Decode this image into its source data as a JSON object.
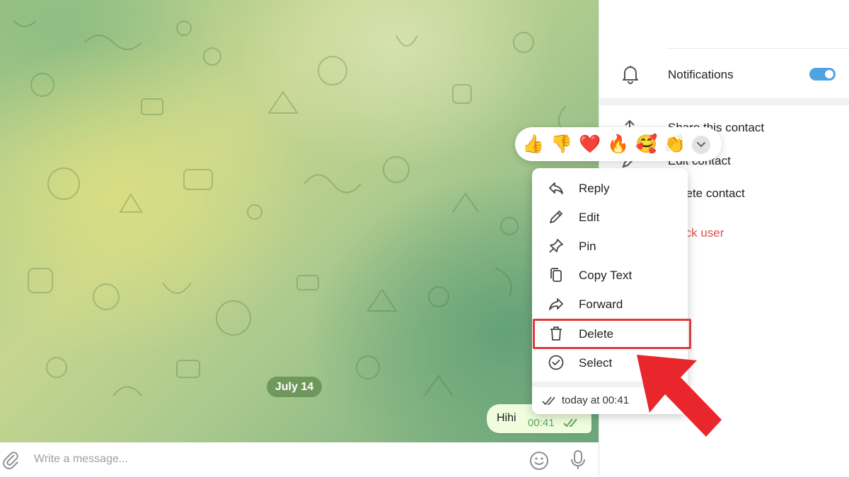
{
  "chat": {
    "date_separator": "July 14",
    "message": {
      "text": "Hihi",
      "time": "00:41",
      "status": "read"
    },
    "input_placeholder": "Write a message..."
  },
  "side_panel": {
    "notifications_label": "Notifications",
    "notifications_enabled": true,
    "items": [
      {
        "label": "Share this contact",
        "icon": "share-icon"
      },
      {
        "label": "Edit contact",
        "icon": "pencil-icon"
      },
      {
        "label": "Delete contact",
        "icon": "trash-icon"
      },
      {
        "label": "Block user",
        "icon": "block-icon"
      }
    ]
  },
  "reactions": [
    "👍",
    "👎",
    "❤️",
    "🔥",
    "🥰",
    "👏"
  ],
  "context_menu": {
    "items": [
      {
        "label": "Reply",
        "icon": "reply-icon"
      },
      {
        "label": "Edit",
        "icon": "pencil-icon"
      },
      {
        "label": "Pin",
        "icon": "pin-icon"
      },
      {
        "label": "Copy Text",
        "icon": "copy-icon"
      },
      {
        "label": "Forward",
        "icon": "forward-icon"
      },
      {
        "label": "Delete",
        "icon": "trash-icon"
      },
      {
        "label": "Select",
        "icon": "check-circle-icon"
      }
    ],
    "footer": "today at 00:41",
    "highlighted_item": "Delete"
  },
  "colors": {
    "accent": "#4fa3e0",
    "highlight": "#e03a3a",
    "danger": "#e0514b",
    "bubble": "#effdde",
    "bubble_time": "#5ea35a"
  }
}
